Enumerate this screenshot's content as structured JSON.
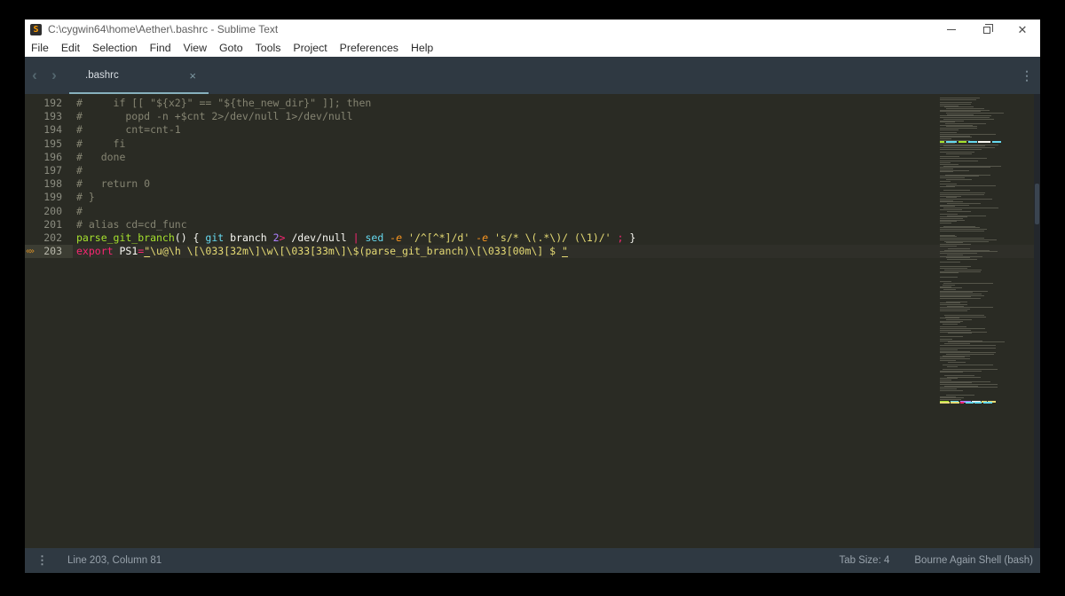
{
  "window": {
    "title": "C:\\cygwin64\\home\\Aether\\.bashrc - Sublime Text",
    "app_icon_letter": "S"
  },
  "menu": {
    "items": [
      "File",
      "Edit",
      "Selection",
      "Find",
      "View",
      "Goto",
      "Tools",
      "Project",
      "Preferences",
      "Help"
    ]
  },
  "tabs": {
    "active_label": ".bashrc",
    "close_icon": "×",
    "back_icon": "‹",
    "forward_icon": "›",
    "overflow_icon": "⋮"
  },
  "editor": {
    "lines": [
      {
        "num": "192",
        "tokens": [
          {
            "t": "#     if [[ \"${x2}\" == \"${the_new_dir}\" ]]; then",
            "c": "comment"
          }
        ]
      },
      {
        "num": "193",
        "tokens": [
          {
            "t": "#       popd -n +$cnt 2>/dev/null 1>/dev/null",
            "c": "comment"
          }
        ]
      },
      {
        "num": "194",
        "tokens": [
          {
            "t": "#       cnt=cnt-1",
            "c": "comment"
          }
        ]
      },
      {
        "num": "195",
        "tokens": [
          {
            "t": "#     fi",
            "c": "comment"
          }
        ]
      },
      {
        "num": "196",
        "tokens": [
          {
            "t": "#   done",
            "c": "comment"
          }
        ]
      },
      {
        "num": "197",
        "tokens": [
          {
            "t": "#",
            "c": "comment"
          }
        ]
      },
      {
        "num": "198",
        "tokens": [
          {
            "t": "#   return 0",
            "c": "comment"
          }
        ]
      },
      {
        "num": "199",
        "tokens": [
          {
            "t": "# }",
            "c": "comment"
          }
        ]
      },
      {
        "num": "200",
        "tokens": [
          {
            "t": "#",
            "c": "comment"
          }
        ]
      },
      {
        "num": "201",
        "tokens": [
          {
            "t": "# alias cd=cd_func",
            "c": "comment"
          }
        ]
      },
      {
        "num": "202",
        "tokens": [
          {
            "t": "parse_git_branch",
            "c": "fn"
          },
          {
            "t": "() { ",
            "c": "plain"
          },
          {
            "t": "git",
            "c": "builtin"
          },
          {
            "t": " branch ",
            "c": "plain"
          },
          {
            "t": "2",
            "c": "num"
          },
          {
            "t": ">",
            "c": "kw"
          },
          {
            "t": " /dev/null ",
            "c": "plain"
          },
          {
            "t": "|",
            "c": "kw"
          },
          {
            "t": " ",
            "c": "plain"
          },
          {
            "t": "sed",
            "c": "builtin"
          },
          {
            "t": " ",
            "c": "plain"
          },
          {
            "t": "-e",
            "c": "param"
          },
          {
            "t": " ",
            "c": "plain"
          },
          {
            "t": "'/^[^*]/d'",
            "c": "str"
          },
          {
            "t": " ",
            "c": "plain"
          },
          {
            "t": "-e",
            "c": "param"
          },
          {
            "t": " ",
            "c": "plain"
          },
          {
            "t": "'s/* \\(.*\\)/ (\\1)/'",
            "c": "str"
          },
          {
            "t": " ",
            "c": "plain"
          },
          {
            "t": ";",
            "c": "kw"
          },
          {
            "t": " }",
            "c": "plain"
          }
        ]
      },
      {
        "num": "203",
        "current": true,
        "gutter_icon": "«»",
        "tokens": [
          {
            "t": "export",
            "c": "kw"
          },
          {
            "t": " PS1",
            "c": "plain"
          },
          {
            "t": "=",
            "c": "kw"
          },
          {
            "t": "\"",
            "c": "str",
            "u": true
          },
          {
            "t": "\\u@\\h \\[\\033[32m\\]\\w\\[\\033[33m\\]\\$(parse_git_branch)\\[\\033[00m\\] $ ",
            "c": "str"
          },
          {
            "t": "\"",
            "c": "str",
            "u": true
          }
        ]
      }
    ]
  },
  "minimap": {
    "seed": 11,
    "rows": 203,
    "row_pitch": 1.7,
    "colored_rows": [
      29,
      201,
      202
    ],
    "bar_color": "#55554a",
    "palette": [
      "#a6e22e",
      "#f92672",
      "#ae81ff",
      "#66d9ef",
      "#e6db74",
      "#f8f8f2"
    ]
  },
  "status": {
    "menu_icon": "⋮",
    "position": "Line 203, Column 81",
    "tab_size": "Tab Size: 4",
    "syntax": "Bourne Again Shell (bash)"
  },
  "colors": {
    "editor_bg": "#2a2b24",
    "chrome_bg": "#2f3942",
    "titlebar_bg": "#ffffff",
    "tab_underline": "#87b1bd",
    "accent_orange": "#ff9d00"
  }
}
